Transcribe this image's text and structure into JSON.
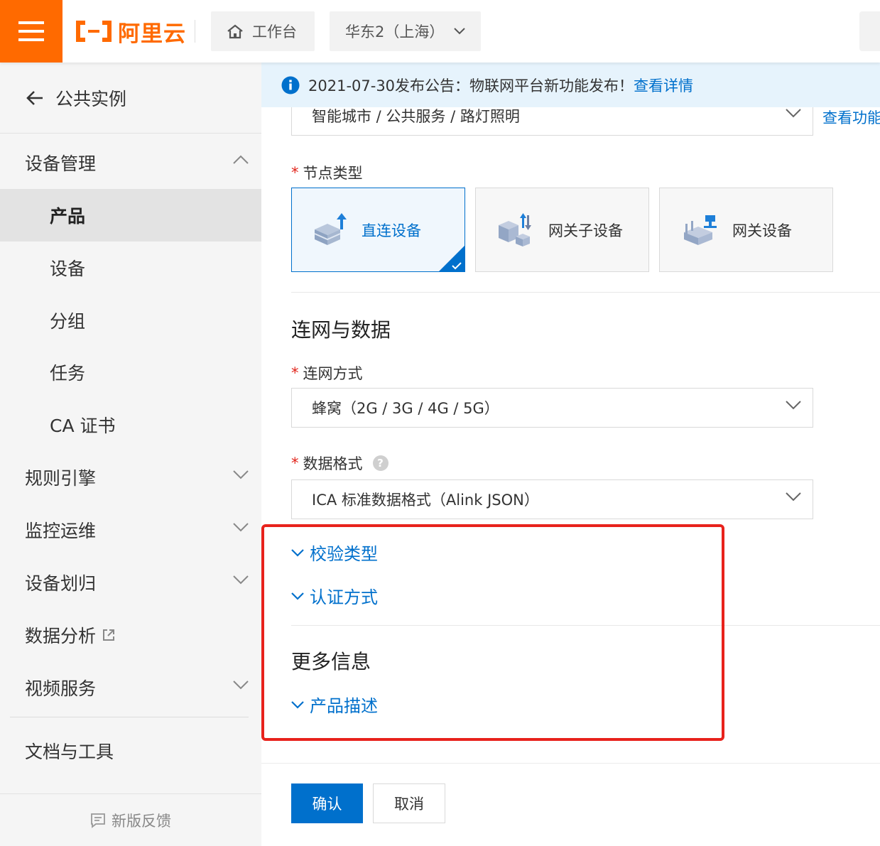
{
  "header": {
    "brand": "阿里云",
    "workbench_label": "工作台",
    "region_label": "华东2（上海）"
  },
  "sidebar": {
    "back_label": "公共实例",
    "device_management": "设备管理",
    "sub_items": [
      "产品",
      "设备",
      "分组",
      "任务",
      "CA 证书"
    ],
    "groups": [
      "规则引擎",
      "监控运维",
      "设备划归",
      "数据分析",
      "视频服务"
    ],
    "docs_tools": "文档与工具",
    "feedback": "新版反馈"
  },
  "notice": {
    "text": "2021-07-30发布公告：物联网平台新功能发布！",
    "link": "查看详情"
  },
  "form": {
    "category_value": "智能城市 / 公共服务 / 路灯照明",
    "category_link": "查看功能",
    "node_type_label": "节点类型",
    "node_types": [
      "直连设备",
      "网关子设备",
      "网关设备"
    ],
    "network_section_title": "连网与数据",
    "network_label": "连网方式",
    "network_value": "蜂窝（2G / 3G / 4G / 5G）",
    "data_format_label": "数据格式",
    "data_format_value": "ICA 标准数据格式（Alink JSON）",
    "verify_type": "校验类型",
    "auth_method": "认证方式",
    "more_info_title": "更多信息",
    "product_desc": "产品描述"
  },
  "footer": {
    "confirm": "确认",
    "cancel": "取消"
  },
  "colors": {
    "brand_orange": "#ff6a00",
    "link_blue": "#0070cc",
    "highlight_red": "#e8221c"
  }
}
